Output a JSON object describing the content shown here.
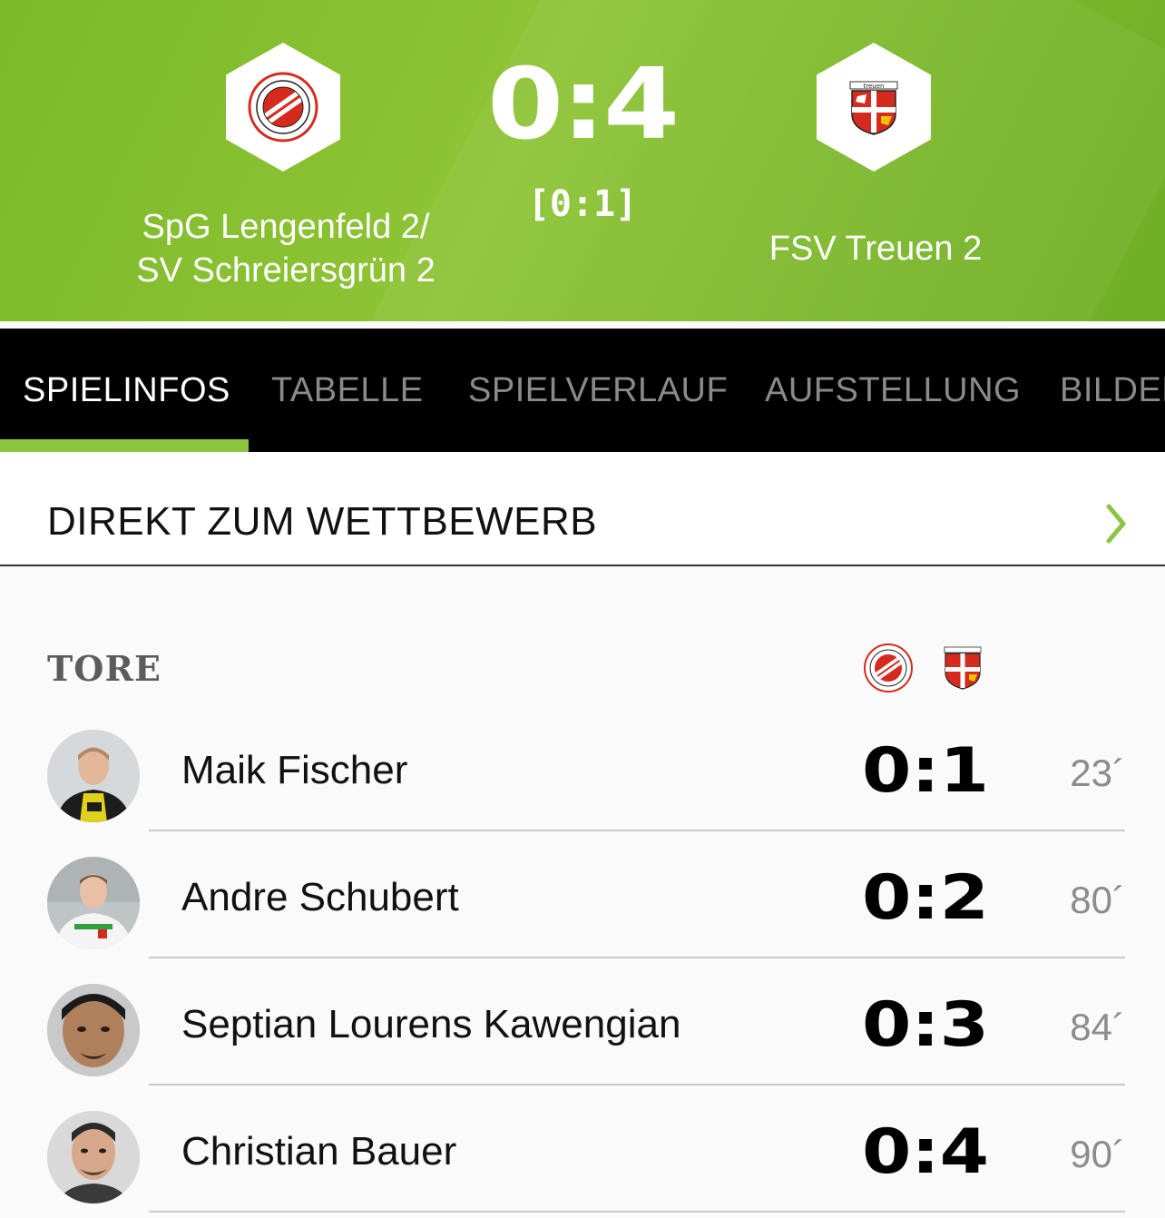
{
  "match": {
    "score": "0:4",
    "halftime": "[0:1]",
    "home_team": {
      "name_line1": "SpG Lengenfeld 2/",
      "name_line2": "SV Schreiersgrün 2",
      "logo_icon": "vfb-lengenfeld-crest-icon"
    },
    "away_team": {
      "name": "FSV Treuen 2",
      "logo_icon": "fsv-treuen-crest-icon"
    },
    "colors": {
      "header_green": "#8fc436",
      "accent_green": "#8bc53f"
    }
  },
  "tabs": [
    {
      "label": "SPIELINFOS",
      "active": true
    },
    {
      "label": "TABELLE",
      "active": false
    },
    {
      "label": "SPIELVERLAUF",
      "active": false
    },
    {
      "label": "AUFSTELLUNG",
      "active": false
    },
    {
      "label": "BILDER",
      "active": false
    }
  ],
  "competition_link": {
    "label": "DIREKT ZUM WETTBEWERB",
    "icon": "chevron-right-icon"
  },
  "goals": {
    "title": "TORE",
    "items": [
      {
        "player": "Maik Fischer",
        "score": "0:1",
        "minute": "23´"
      },
      {
        "player": "Andre Schubert",
        "score": "0:2",
        "minute": "80´"
      },
      {
        "player": "Septian Lourens Kawengian",
        "score": "0:3",
        "minute": "84´"
      },
      {
        "player": "Christian Bauer",
        "score": "0:4",
        "minute": "90´"
      }
    ]
  }
}
